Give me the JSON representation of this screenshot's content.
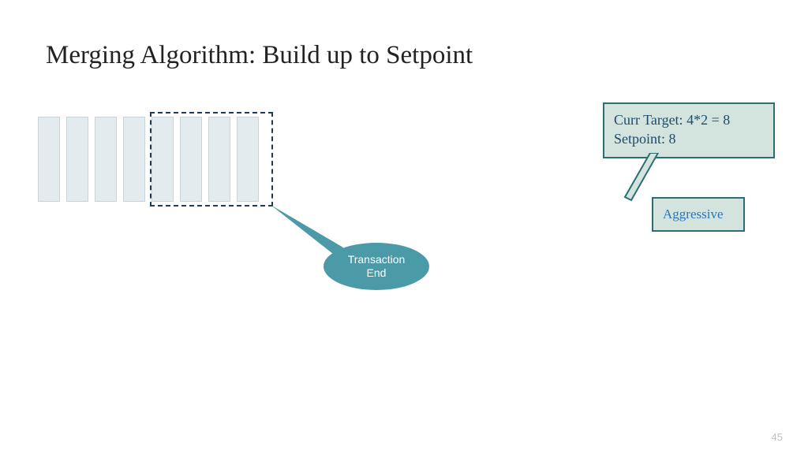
{
  "title": "Merging Algorithm: Build up to Setpoint",
  "info": {
    "curr_label": "Curr Target:",
    "curr_value": "4*2 = 8",
    "setpoint_label": "Setpoint:",
    "setpoint_value": "8"
  },
  "aggressive_label": "Aggressive",
  "ellipse": {
    "line1": "Transaction",
    "line2": "End"
  },
  "page_number": "45",
  "bar_count": 8,
  "dashed_group_size": 4
}
